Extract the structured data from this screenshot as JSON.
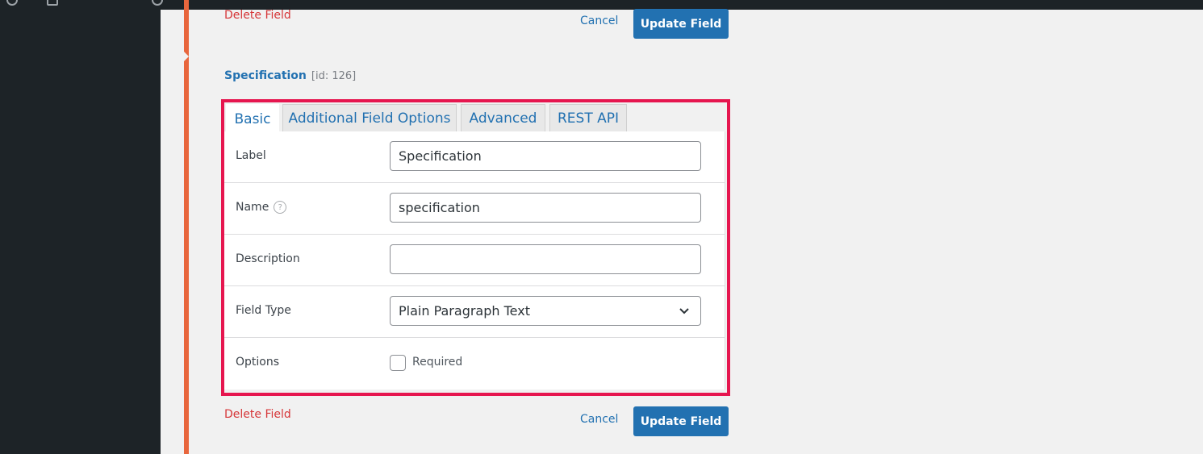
{
  "top_actions": {
    "delete_label": "Delete Field",
    "cancel_label": "Cancel",
    "update_label": "Update Field"
  },
  "field": {
    "name": "Specification",
    "id_text": "[id: 126]"
  },
  "tabs": [
    {
      "label": "Basic",
      "active": true
    },
    {
      "label": "Additional Field Options",
      "active": false
    },
    {
      "label": "Advanced",
      "active": false
    },
    {
      "label": "REST API",
      "active": false
    }
  ],
  "form": {
    "label": {
      "label": "Label",
      "value": "Specification"
    },
    "name": {
      "label": "Name",
      "value": "specification",
      "help_icon": "question-circle-icon",
      "help_glyph": "?"
    },
    "description": {
      "label": "Description",
      "value": ""
    },
    "field_type": {
      "label": "Field Type",
      "selected": "Plain Paragraph Text"
    },
    "options": {
      "label": "Options",
      "required_label": "Required",
      "required_checked": false
    }
  },
  "bottom_actions": {
    "delete_label": "Delete Field",
    "cancel_label": "Cancel",
    "update_label": "Update Field"
  },
  "colors": {
    "accent_bar": "#e8663d",
    "highlight_border": "#e6164f",
    "primary": "#2271b1",
    "danger": "#d63638",
    "admin_dark": "#1d2327"
  }
}
